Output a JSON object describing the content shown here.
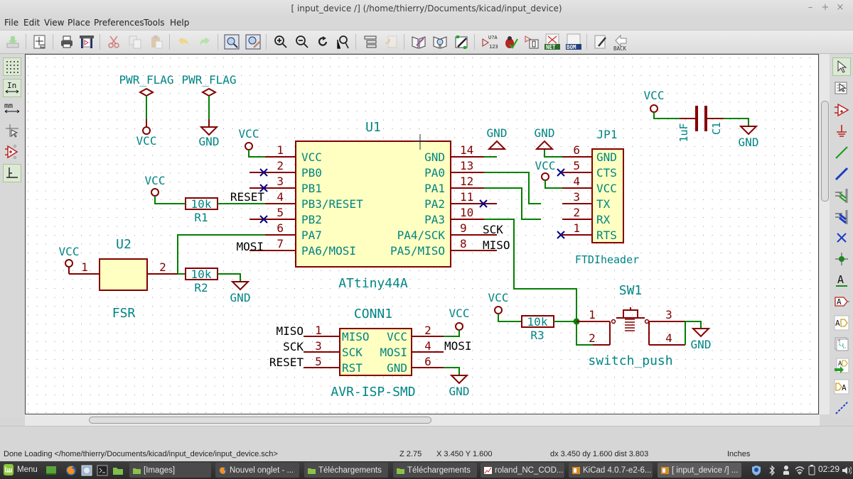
{
  "window": {
    "title": "[ input_device /] (/home/thierry/Documents/kicad/input_device)",
    "controls": {
      "minimize": "–",
      "maximize": "+",
      "close": "×"
    }
  },
  "menu": [
    "File",
    "Edit",
    "View",
    "Place",
    "Preferences",
    "Tools",
    "Help"
  ],
  "toolbar": {
    "buttons": [
      {
        "name": "save-icon",
        "label": "Save"
      },
      {
        "name": "page-settings-icon",
        "label": "Page settings"
      },
      {
        "name": "print-icon",
        "label": "Print"
      },
      {
        "name": "plot-icon",
        "label": "Plot"
      },
      {
        "name": "cut-icon",
        "label": "Cut"
      },
      {
        "name": "copy-icon",
        "label": "Copy"
      },
      {
        "name": "paste-icon",
        "label": "Paste"
      },
      {
        "name": "undo-icon",
        "label": "Undo"
      },
      {
        "name": "redo-icon",
        "label": "Redo"
      },
      {
        "name": "find-icon",
        "label": "Find"
      },
      {
        "name": "find-replace-icon",
        "label": "Find and replace"
      },
      {
        "name": "zoom-in-icon",
        "label": "Zoom in"
      },
      {
        "name": "zoom-out-icon",
        "label": "Zoom out"
      },
      {
        "name": "redraw-icon",
        "label": "Redraw"
      },
      {
        "name": "zoom-fit-icon",
        "label": "Zoom to fit"
      },
      {
        "name": "hierarchy-icon",
        "label": "Navigate hierarchy"
      },
      {
        "name": "leave-sheet-icon",
        "label": "Leave sheet"
      },
      {
        "name": "library-editor-icon",
        "label": "Library editor"
      },
      {
        "name": "library-browser-icon",
        "label": "Library browser"
      },
      {
        "name": "footprint-editor-icon",
        "label": "Footprint editor"
      },
      {
        "name": "annotate-icon",
        "label": "U?A 123"
      },
      {
        "name": "erc-icon",
        "label": "ERC"
      },
      {
        "name": "cvpcb-icon",
        "label": "Assign footprints"
      },
      {
        "name": "netlist-icon",
        "label": "NET"
      },
      {
        "name": "bom-icon",
        "label": "BOM"
      },
      {
        "name": "pcbnew-icon",
        "label": "Pcbnew"
      },
      {
        "name": "back-annotate-icon",
        "label": "BACK"
      }
    ]
  },
  "left_tools": [
    {
      "name": "grid-toggle-icon",
      "label": "Show grid",
      "active": true
    },
    {
      "name": "units-inches-icon",
      "label": "In",
      "active": true
    },
    {
      "name": "units-mm-icon",
      "label": "mm",
      "active": false
    },
    {
      "name": "cursor-shape-icon",
      "label": "Cursor",
      "active": false
    },
    {
      "name": "hidden-pins-icon",
      "label": "Show hidden pins",
      "active": false
    },
    {
      "name": "orthogonal-wires-icon",
      "label": "H/V wires",
      "active": true
    }
  ],
  "right_tools": [
    {
      "name": "select-arrow-icon",
      "label": "Select",
      "active": true
    },
    {
      "name": "highlight-net-icon",
      "label": "Highlight net"
    },
    {
      "name": "place-component-icon",
      "label": "Place component"
    },
    {
      "name": "place-power-icon",
      "label": "Place power"
    },
    {
      "name": "place-wire-icon",
      "label": "Place wire"
    },
    {
      "name": "place-bus-icon",
      "label": "Place bus"
    },
    {
      "name": "wire-bus-entry-icon",
      "label": "Wire to bus entry"
    },
    {
      "name": "bus-bus-entry-icon",
      "label": "Bus to bus entry"
    },
    {
      "name": "no-connect-icon",
      "label": "No connect"
    },
    {
      "name": "junction-icon",
      "label": "Junction"
    },
    {
      "name": "net-label-icon",
      "label": "A"
    },
    {
      "name": "global-label-icon",
      "label": "A"
    },
    {
      "name": "hier-label-icon",
      "label": "A"
    },
    {
      "name": "hier-sheet-icon",
      "label": "Hierarchical sheet"
    },
    {
      "name": "import-sheet-pin-icon",
      "label": "A"
    },
    {
      "name": "sheet-pin-icon",
      "label": "A"
    },
    {
      "name": "graphic-line-icon",
      "label": "Graphic line"
    }
  ],
  "schematic": {
    "colors": {
      "wire": "#008000",
      "pin": "#840000",
      "body_fill": "#ffffc2",
      "field": "#008484",
      "label": "#000000",
      "noconnect": "#000084",
      "grid": "#9a9a9a"
    },
    "pwr_flags": [
      {
        "label": "PWR_FLAG",
        "net": "VCC"
      },
      {
        "label": "PWR_FLAG",
        "net": "GND"
      }
    ],
    "power_labels": {
      "vcc": "VCC",
      "gnd": "GND"
    },
    "u1": {
      "ref": "U1",
      "value": "ATtiny44A",
      "left_pins": [
        {
          "num": "1",
          "name": "VCC"
        },
        {
          "num": "2",
          "name": "PB0"
        },
        {
          "num": "3",
          "name": "PB1"
        },
        {
          "num": "4",
          "name": "PB3/RESET"
        },
        {
          "num": "5",
          "name": "PB2"
        },
        {
          "num": "6",
          "name": "PA7"
        },
        {
          "num": "7",
          "name": "PA6/MOSI"
        }
      ],
      "right_pins": [
        {
          "num": "14",
          "name": "GND"
        },
        {
          "num": "13",
          "name": "PA0"
        },
        {
          "num": "12",
          "name": "PA1"
        },
        {
          "num": "11",
          "name": "PA2"
        },
        {
          "num": "10",
          "name": "PA3"
        },
        {
          "num": "9",
          "name": "PA4/SCK"
        },
        {
          "num": "8",
          "name": "PA5/MISO"
        }
      ]
    },
    "r1": {
      "ref": "R1",
      "value": "10k"
    },
    "r2": {
      "ref": "R2",
      "value": "10k"
    },
    "r3": {
      "ref": "R3",
      "value": "10k"
    },
    "c1": {
      "ref": "C1",
      "value": "1uF"
    },
    "u2": {
      "ref": "U2",
      "value": "FSR",
      "pins": [
        "1",
        "2"
      ]
    },
    "jp1": {
      "ref": "JP1",
      "value": "FTDIheader",
      "pins": [
        {
          "num": "6",
          "name": "GND"
        },
        {
          "num": "5",
          "name": "CTS"
        },
        {
          "num": "4",
          "name": "VCC"
        },
        {
          "num": "3",
          "name": "TX"
        },
        {
          "num": "2",
          "name": "RX"
        },
        {
          "num": "1",
          "name": "RTS"
        }
      ]
    },
    "conn1": {
      "ref": "CONN1",
      "value": "AVR-ISP-SMD",
      "left_pins": [
        {
          "num": "1",
          "name": "MISO",
          "net": "MISO"
        },
        {
          "num": "3",
          "name": "SCK",
          "net": "SCK"
        },
        {
          "num": "5",
          "name": "RST",
          "net": "RESET"
        }
      ],
      "right_pins": [
        {
          "num": "2",
          "name": "VCC"
        },
        {
          "num": "4",
          "name": "MOSI",
          "net": "MOSI"
        },
        {
          "num": "6",
          "name": "GND"
        }
      ]
    },
    "sw1": {
      "ref": "SW1",
      "value": "switch_push",
      "pins": [
        "1",
        "2",
        "3",
        "4"
      ]
    },
    "net_labels": {
      "reset": "RESET",
      "mosi": "MOSI",
      "sck": "SCK",
      "miso": "MISO"
    }
  },
  "status": {
    "message": "Done Loading </home/thierry/Documents/kicad/input_device/input_device.sch>",
    "zoom": "Z 2.75",
    "coords": "X 3.450  Y 1.600",
    "delta": "dx 3.450  dy 1.600  dist 3.803",
    "units": "Inches"
  },
  "taskbar": {
    "menu_label": "Menu",
    "tasks": [
      {
        "label": "[Images]",
        "icon": "folder"
      },
      {
        "label": "Nouvel onglet - ...",
        "icon": "firefox"
      },
      {
        "label": "Téléchargements",
        "icon": "folder"
      },
      {
        "label": "Téléchargements",
        "icon": "folder"
      },
      {
        "label": "roland_NC_COD...",
        "icon": "chart"
      },
      {
        "label": "KiCad 4.0.7-e2-6...",
        "icon": "kicad"
      },
      {
        "label": "[ input_device /] ...",
        "icon": "kicad",
        "active": true
      }
    ],
    "clock": "02:29"
  }
}
